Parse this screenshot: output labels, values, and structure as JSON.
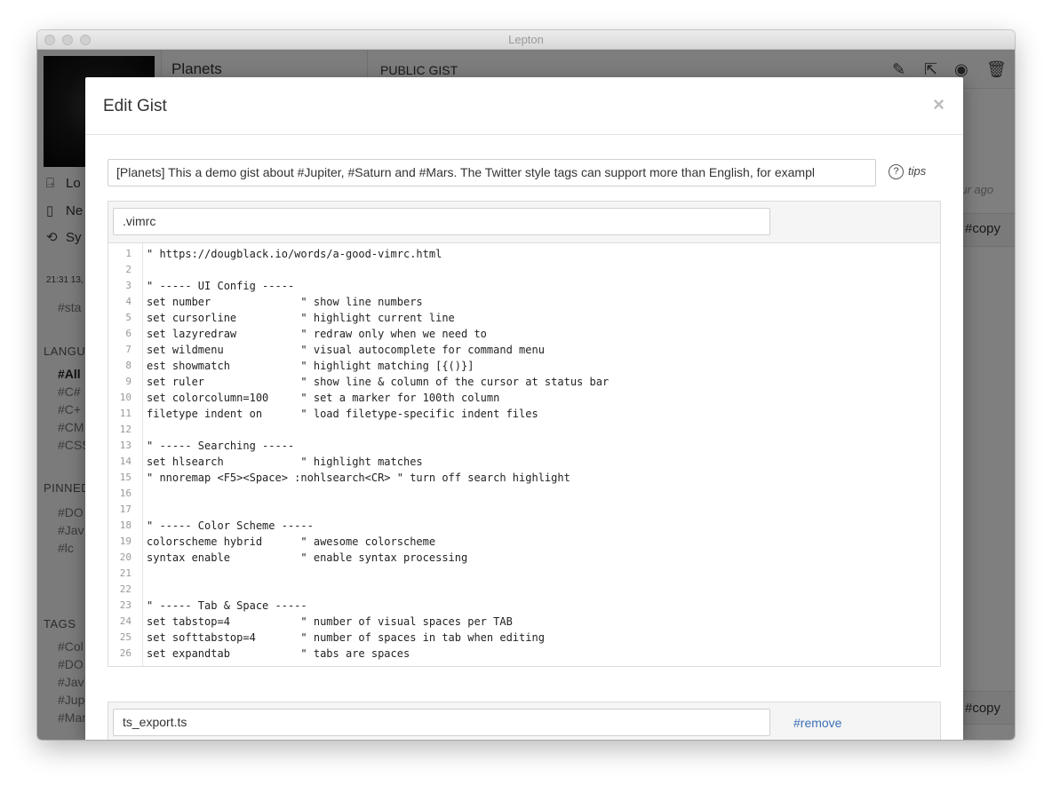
{
  "window": {
    "title": "Lepton"
  },
  "sidebar": {
    "actions": [
      {
        "label": "Lo",
        "icon": "logout-icon",
        "glyph": "⍈"
      },
      {
        "label": "Ne",
        "icon": "new-file-icon",
        "glyph": "▯"
      },
      {
        "label": "Sy",
        "icon": "sync-icon",
        "glyph": "⟲"
      }
    ],
    "sync_time": "21:31 13,",
    "starred": "#sta",
    "languages_head": "LANGU",
    "languages": [
      "#All",
      "#C#",
      "#C+",
      "#CM",
      "#CSS"
    ],
    "pinned_head": "PINNED",
    "pinned": [
      "#DO",
      "#Jav",
      "#lc"
    ],
    "tags_head": "TAGS",
    "tags": [
      "#Col",
      "#DO",
      "#Jav",
      "#Jup",
      "#Mar"
    ]
  },
  "middle": {
    "title": "Planets"
  },
  "right": {
    "label": "PUBLIC GIST",
    "time_fragment": "our ago",
    "copy_1": "#copy",
    "copy_2": "#copy",
    "icons": [
      "edit-icon",
      "open-external-icon",
      "eye-icon",
      "trash-icon"
    ]
  },
  "modal": {
    "title": "Edit Gist",
    "close_glyph": "×",
    "description": "[Planets] This a demo gist about #Jupiter, #Saturn and #Mars. The Twitter style tags can support more than English, for exampl",
    "tips_label": "tips",
    "tips_glyph": "?",
    "file1": {
      "name": ".vimrc",
      "lines": [
        "\" https://dougblack.io/words/a-good-vimrc.html",
        "",
        "\" ----- UI Config -----",
        "set number              \" show line numbers",
        "set cursorline          \" highlight current line",
        "set lazyredraw          \" redraw only when we need to",
        "set wildmenu            \" visual autocomplete for command menu",
        "est showmatch           \" highlight matching [{()}]",
        "set ruler               \" show line & column of the cursor at status bar",
        "set colorcolumn=100     \" set a marker for 100th column",
        "filetype indent on      \" load filetype-specific indent files",
        "",
        "\" ----- Searching -----",
        "set hlsearch            \" highlight matches",
        "\" nnoremap <F5><Space> :nohlsearch<CR> \" turn off search highlight",
        "",
        "",
        "\" ----- Color Scheme -----",
        "colorscheme hybrid      \" awesome colorscheme",
        "syntax enable           \" enable syntax processing",
        "",
        "",
        "\" ----- Tab & Space -----",
        "set tabstop=4           \" number of visual spaces per TAB",
        "set softtabstop=4       \" number of spaces in tab when editing",
        "set expandtab           \" tabs are spaces"
      ]
    },
    "file2": {
      "name": "ts_export.ts",
      "remove_label": "#remove"
    }
  }
}
